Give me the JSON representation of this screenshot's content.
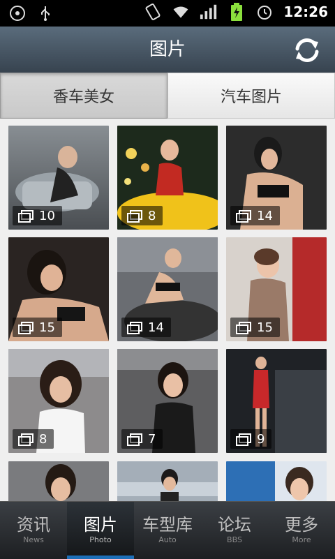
{
  "status_bar": {
    "time": "12:26",
    "icons": [
      "disc-icon",
      "usb-icon",
      "vibrate-icon",
      "wifi-icon",
      "signal-icon",
      "battery-charging-icon",
      "alarm-icon"
    ]
  },
  "header": {
    "title": "图片",
    "refresh_icon": "refresh-icon"
  },
  "sub_tabs": [
    {
      "label": "香车美女",
      "active": true
    },
    {
      "label": "汽车图片",
      "active": false
    }
  ],
  "gallery": [
    {
      "count": "10",
      "bg": "#6f7479"
    },
    {
      "count": "8",
      "bg": "#c0342c"
    },
    {
      "count": "14",
      "bg": "#2a2a2a"
    },
    {
      "count": "15",
      "bg": "#3a3230"
    },
    {
      "count": "14",
      "bg": "#5d5f63"
    },
    {
      "count": "15",
      "bg": "#b7a89f"
    },
    {
      "count": "8",
      "bg": "#6c6c6e"
    },
    {
      "count": "7",
      "bg": "#585858"
    },
    {
      "count": "9",
      "bg": "#1e2226"
    },
    {
      "count": "",
      "bg": "#7a7b7e"
    },
    {
      "count": "",
      "bg": "#9da7b1"
    },
    {
      "count": "",
      "bg": "#b8c6d6"
    }
  ],
  "bottom_nav": [
    {
      "label": "资讯",
      "sublabel": "News",
      "active": false
    },
    {
      "label": "图片",
      "sublabel": "Photo",
      "active": true
    },
    {
      "label": "车型库",
      "sublabel": "Auto",
      "active": false
    },
    {
      "label": "论坛",
      "sublabel": "BBS",
      "active": false
    },
    {
      "label": "更多",
      "sublabel": "More",
      "active": false
    }
  ],
  "colors": {
    "accent": "#1d6fb8",
    "header_top": "#5a6c7c",
    "header_bottom": "#37434f"
  }
}
